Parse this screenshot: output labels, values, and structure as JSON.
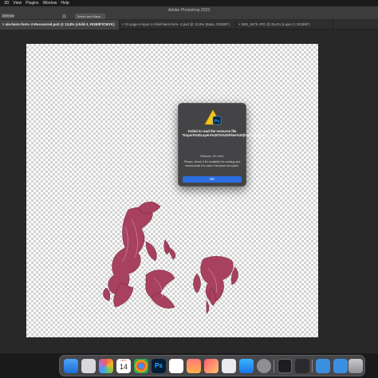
{
  "menubar": {
    "items": [
      "3D",
      "View",
      "Plugins",
      "Window",
      "Help"
    ]
  },
  "optionsbar": {
    "app_title": "Adobe Photoshop 2023",
    "tool_dropdown_label": "Airbrush",
    "select_mask_label": "Select and Mask..."
  },
  "tabs": [
    {
      "label": "ale-hairs-form--2-Recovered.psd @ 13,8% (child-3, RGB/8*/CMYK)",
      "active": true,
      "closable": true
    },
    {
      "label": "IG-page-4-layer-2-child-hairs-form--2.psd @ 13,6% (Base, RGB/8*)",
      "active": false,
      "closable": true
    },
    {
      "label": "IMG_8475.JPG @ 25,4% (Layer 0, RGB/8*)",
      "active": false,
      "closable": true
    }
  ],
  "dialog": {
    "title": "Failed to read the resource file \"Export%20Layers%20To%20Files%20(Fast)_progress_bar.json\"",
    "reason": "Reason: I/O error",
    "body": "Please, check if it's available for reading and redownload it in case it became corrupted.",
    "ok_label": "OK"
  },
  "dock": {
    "calendar_month": "AUG",
    "calendar_day": "14",
    "photoshop_label": "Ps"
  },
  "colors": {
    "accent": "#2c6de0",
    "artwork": "#a8415f"
  }
}
